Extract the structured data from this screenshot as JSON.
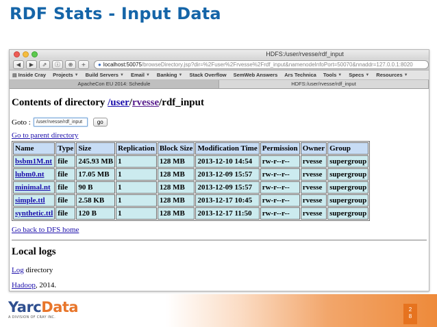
{
  "slide": {
    "title": "RDF Stats - Input Data",
    "page_number_line1": "2",
    "page_number_line2": "8"
  },
  "browser": {
    "window_title": "HDFS:/user/rvesse/rdf_input",
    "url_host": "localhost:50075",
    "url_rest": "/browseDirectory.jsp?dir=%2Fuser%2Frvesse%2Frdf_input&namenodeInfoPort=50070&nnaddr=127.0.0.1:8020",
    "toolbar": {
      "back": "◀",
      "forward": "▶",
      "share": "⇗",
      "reader": "ⓘ",
      "downloads": "⊕",
      "newtab": "+"
    },
    "bookmarks": [
      {
        "label": "Inside Cray",
        "icon": "book-icon",
        "has_menu": false
      },
      {
        "label": "Projects",
        "icon": "",
        "has_menu": true
      },
      {
        "label": "Build Servers",
        "icon": "",
        "has_menu": true
      },
      {
        "label": "Email",
        "icon": "",
        "has_menu": true
      },
      {
        "label": "Banking",
        "icon": "",
        "has_menu": true
      },
      {
        "label": "Stack Overflow",
        "icon": "",
        "has_menu": false
      },
      {
        "label": "SemWeb Answers",
        "icon": "",
        "has_menu": false
      },
      {
        "label": "Ars Technica",
        "icon": "",
        "has_menu": false
      },
      {
        "label": "Tools",
        "icon": "",
        "has_menu": true
      },
      {
        "label": "Specs",
        "icon": "",
        "has_menu": true
      },
      {
        "label": "Resources",
        "icon": "",
        "has_menu": true
      }
    ],
    "tabs": [
      {
        "label": "ApacheCon EU 2014: Schedule"
      },
      {
        "label": "HDFS:/user/rvesse/rdf_input"
      }
    ]
  },
  "page": {
    "contents_prefix": "Contents of directory ",
    "path_user": "/user",
    "path_sep": "/",
    "path_rvesse": "rvesse",
    "path_rest": "/rdf_input",
    "goto_label": "Goto : ",
    "goto_value": "/user/rvesse/rdf_input",
    "go_button": "go",
    "parent_link": "Go to parent directory",
    "table": {
      "headers": [
        "Name",
        "Type",
        "Size",
        "Replication",
        "Block Size",
        "Modification Time",
        "Permission",
        "Owner",
        "Group"
      ],
      "rows": [
        [
          "bsbm1M.nt",
          "file",
          "245.93 MB",
          "1",
          "128 MB",
          "2013-12-10 14:54",
          "rw-r--r--",
          "rvesse",
          "supergroup"
        ],
        [
          "lubm0.nt",
          "file",
          "17.05 MB",
          "1",
          "128 MB",
          "2013-12-09 15:57",
          "rw-r--r--",
          "rvesse",
          "supergroup"
        ],
        [
          "minimal.nt",
          "file",
          "90 B",
          "1",
          "128 MB",
          "2013-12-09 15:57",
          "rw-r--r--",
          "rvesse",
          "supergroup"
        ],
        [
          "simple.ttl",
          "file",
          "2.58 KB",
          "1",
          "128 MB",
          "2013-12-17 10:45",
          "rw-r--r--",
          "rvesse",
          "supergroup"
        ],
        [
          "synthetic.ttl",
          "file",
          "120 B",
          "1",
          "128 MB",
          "2013-12-17 11:50",
          "rw-r--r--",
          "rvesse",
          "supergroup"
        ]
      ]
    },
    "dfs_home_link": "Go back to DFS home",
    "local_logs_heading": "Local logs",
    "log_link": "Log",
    "log_suffix": " directory",
    "hadoop_link": "Hadoop",
    "hadoop_suffix": ", 2014."
  },
  "footer": {
    "logo_yarc": "Yarc",
    "logo_data": "Data",
    "logo_sub": "A DIVISION OF CRAY INC."
  },
  "colors": {
    "title_blue": "#1565a8",
    "header_cell": "#c7dcf5",
    "data_cell": "#ccebef",
    "accent_orange": "#e6731f"
  }
}
